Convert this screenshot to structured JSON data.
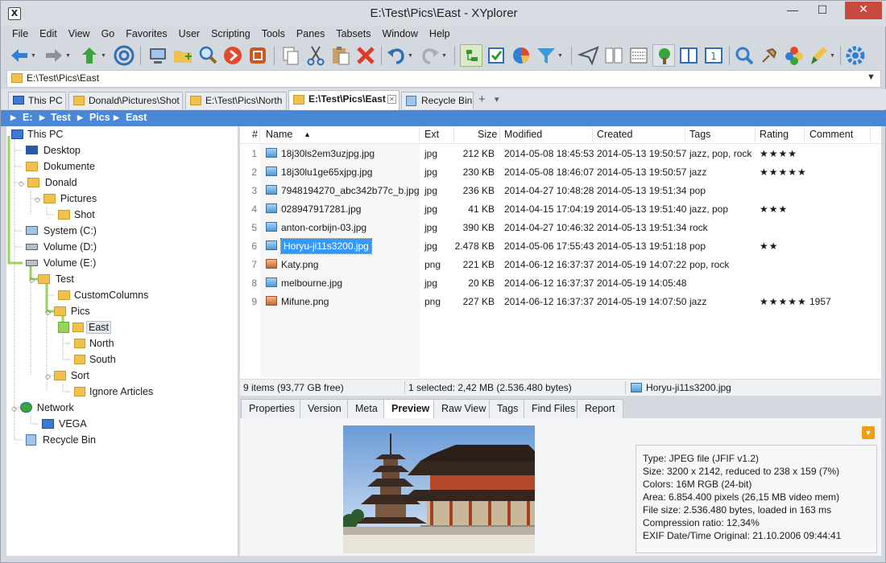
{
  "window": {
    "title": "E:\\Test\\Pics\\East - XYplorer",
    "min": "—",
    "max": "☐",
    "close": "✕",
    "logo": "X"
  },
  "menu": [
    "File",
    "Edit",
    "View",
    "Go",
    "Favorites",
    "User",
    "Scripting",
    "Tools",
    "Panes",
    "Tabsets",
    "Window",
    "Help"
  ],
  "toolbar_icons": [
    "back-icon",
    "forward-icon",
    "up-icon",
    "target-icon",
    "computer-icon",
    "new-folder-icon",
    "find-icon",
    "goto-icon",
    "tag-icon",
    "copy-icon",
    "cut-icon",
    "paste-icon",
    "delete-icon",
    "undo-icon",
    "redo-icon",
    "tree-toggle-icon",
    "checkbox-icon",
    "pie-chart-icon",
    "filter-icon",
    "send-icon",
    "dual-pane-icon",
    "details-view-icon",
    "tree-view-icon",
    "pane-layout-icon",
    "pane-number-icon",
    "search-icon",
    "pin-icon",
    "color-filter-icon",
    "brush-icon",
    "settings-icon"
  ],
  "address": {
    "value": "E:\\Test\\Pics\\East"
  },
  "tabs": [
    {
      "label": "This PC",
      "icon": "computer-icon"
    },
    {
      "label": "Donald\\Pictures\\Shot",
      "icon": "folder-icon"
    },
    {
      "label": "E:\\Test\\Pics\\North",
      "icon": "folder-icon"
    },
    {
      "label": "E:\\Test\\Pics\\East",
      "icon": "folder-icon",
      "active": true,
      "close": "✕"
    },
    {
      "label": "Recycle Bin",
      "icon": "recycle-bin-icon"
    }
  ],
  "tab_add": "+",
  "tab_menu": "▾",
  "breadcrumb": [
    "E:",
    "Test",
    "Pics",
    "East"
  ],
  "tree": [
    {
      "label": "This PC",
      "icon": "computer"
    },
    {
      "label": "Desktop",
      "icon": "desktop"
    },
    {
      "label": "Dokumente",
      "icon": "folder"
    },
    {
      "label": "Donald",
      "icon": "user-folder"
    },
    {
      "label": "Pictures",
      "icon": "folder"
    },
    {
      "label": "Shot",
      "icon": "folder"
    },
    {
      "label": "System (C:)",
      "icon": "drive-windows"
    },
    {
      "label": "Volume (D:)",
      "icon": "drive"
    },
    {
      "label": "Volume (E:)",
      "icon": "drive"
    },
    {
      "label": "Test",
      "icon": "folder"
    },
    {
      "label": "CustomColumns",
      "icon": "folder"
    },
    {
      "label": "Pics",
      "icon": "folder"
    },
    {
      "label": "East",
      "icon": "folder",
      "selected": true
    },
    {
      "label": "North",
      "icon": "folder"
    },
    {
      "label": "South",
      "icon": "folder"
    },
    {
      "label": "Sort",
      "icon": "folder"
    },
    {
      "label": "Ignore Articles",
      "icon": "folder"
    },
    {
      "label": "Network",
      "icon": "network"
    },
    {
      "label": "VEGA",
      "icon": "computer"
    },
    {
      "label": "Recycle Bin",
      "icon": "recycle-bin"
    }
  ],
  "list": {
    "columns": [
      "#",
      "Name",
      "Ext",
      "Size",
      "Modified",
      "Created",
      "Tags",
      "Rating",
      "Comment"
    ],
    "sort_indicator": "▲",
    "rows": [
      {
        "n": "1",
        "name": "18j30ls2em3uzjpg.jpg",
        "ext": "jpg",
        "size": "212 KB",
        "modified": "2014-05-08 18:45:53",
        "created": "2014-05-13 19:50:57",
        "tags": "jazz, pop, rock",
        "rating": "★★★★",
        "comment": ""
      },
      {
        "n": "2",
        "name": "18j30lu1ge65xjpg.jpg",
        "ext": "jpg",
        "size": "230 KB",
        "modified": "2014-05-08 18:46:07",
        "created": "2014-05-13 19:50:57",
        "tags": "jazz",
        "rating": "★★★★★",
        "comment": ""
      },
      {
        "n": "3",
        "name": "7948194270_abc342b77c_b.jpg",
        "ext": "jpg",
        "size": "236 KB",
        "modified": "2014-04-27 10:48:28",
        "created": "2014-05-13 19:51:34",
        "tags": "pop",
        "rating": "",
        "comment": ""
      },
      {
        "n": "4",
        "name": "028947917281.jpg",
        "ext": "jpg",
        "size": "41 KB",
        "modified": "2014-04-15 17:04:19",
        "created": "2014-05-13 19:51:40",
        "tags": "jazz, pop",
        "rating": "★★★",
        "comment": ""
      },
      {
        "n": "5",
        "name": "anton-corbijn-03.jpg",
        "ext": "jpg",
        "size": "390 KB",
        "modified": "2014-04-27 10:46:32",
        "created": "2014-05-13 19:51:34",
        "tags": "rock",
        "rating": "",
        "comment": ""
      },
      {
        "n": "6",
        "name": "Horyu-ji11s3200.jpg",
        "ext": "jpg",
        "size": "2.478 KB",
        "modified": "2014-05-06 17:55:43",
        "created": "2014-05-13 19:51:18",
        "tags": "pop",
        "rating": "★★",
        "comment": "",
        "selected": true
      },
      {
        "n": "7",
        "name": "Katy.png",
        "ext": "png",
        "size": "221 KB",
        "modified": "2014-06-12 16:37:37",
        "created": "2014-05-19 14:07:22",
        "tags": "pop, rock",
        "rating": "",
        "comment": ""
      },
      {
        "n": "8",
        "name": "melbourne.jpg",
        "ext": "jpg",
        "size": "20 KB",
        "modified": "2014-06-12 16:37:37",
        "created": "2014-05-19 14:05:48",
        "tags": "",
        "rating": "",
        "comment": ""
      },
      {
        "n": "9",
        "name": "Mifune.png",
        "ext": "png",
        "size": "227 KB",
        "modified": "2014-06-12 16:37:37",
        "created": "2014-05-19 14:07:50",
        "tags": "jazz",
        "rating": "★★★★★",
        "comment": "1957"
      }
    ]
  },
  "status": {
    "items": "9 items (93,77 GB free)",
    "selected": "1 selected: 2,42 MB (2.536.480 bytes)",
    "file": "Horyu-ji11s3200.jpg"
  },
  "info_tabs": [
    "Properties",
    "Version",
    "Meta",
    "Preview",
    "Raw View",
    "Tags",
    "Find Files",
    "Report"
  ],
  "info_active": "Preview",
  "preview_info": [
    "Type: JPEG file (JFIF v1.2)",
    "Size: 3200 x 2142, reduced to 238 x 159 (7%)",
    "Colors: 16M RGB (24-bit)",
    "Area: 6.854.400 pixels (26,15 MB video mem)",
    "File size: 2.536.480 bytes, loaded in 163 ms",
    "Compression ratio: 12,34%",
    "EXIF Date/Time Original: 21.10.2006 09:44:41"
  ],
  "colors": {
    "accent": "#4a87d6",
    "selection": "#3399ff",
    "tree_line": "#9ad35a",
    "folder": "#f0c14b"
  }
}
